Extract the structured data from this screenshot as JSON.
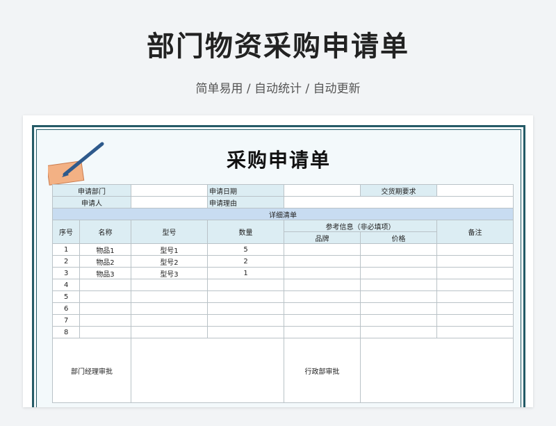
{
  "hero": {
    "title": "部门物资采购申请单",
    "subtitle": "简单易用 / 自动统计 / 自动更新"
  },
  "sheet": {
    "title": "采购申请单",
    "icon": "note-pencil-icon",
    "fields": {
      "dept_label": "申请部门",
      "date_label": "申请日期",
      "delivery_label": "交货期要求",
      "applicant_label": "申请人",
      "reason_label": "申请理由"
    },
    "section_label": "详细清单",
    "columns": {
      "index": "序号",
      "name": "名称",
      "model": "型号",
      "qty": "数量",
      "ref_group": "参考信息（非必填项）",
      "brand": "品牌",
      "price": "价格",
      "remark": "备注"
    },
    "rows": [
      {
        "index": "1",
        "name": "物品1",
        "model": "型号1",
        "qty": "5",
        "brand": "",
        "price": "",
        "remark": ""
      },
      {
        "index": "2",
        "name": "物品2",
        "model": "型号2",
        "qty": "2",
        "brand": "",
        "price": "",
        "remark": ""
      },
      {
        "index": "3",
        "name": "物品3",
        "model": "型号3",
        "qty": "1",
        "brand": "",
        "price": "",
        "remark": ""
      },
      {
        "index": "4",
        "name": "",
        "model": "",
        "qty": "",
        "brand": "",
        "price": "",
        "remark": ""
      },
      {
        "index": "5",
        "name": "",
        "model": "",
        "qty": "",
        "brand": "",
        "price": "",
        "remark": ""
      },
      {
        "index": "6",
        "name": "",
        "model": "",
        "qty": "",
        "brand": "",
        "price": "",
        "remark": ""
      },
      {
        "index": "7",
        "name": "",
        "model": "",
        "qty": "",
        "brand": "",
        "price": "",
        "remark": ""
      },
      {
        "index": "8",
        "name": "",
        "model": "",
        "qty": "",
        "brand": "",
        "price": "",
        "remark": ""
      }
    ],
    "approvals": {
      "dept_manager": "部门经理审批",
      "admin_dept": "行政部审批"
    }
  },
  "colors": {
    "frame": "#245a66",
    "label_bg": "#dcedf3",
    "section_bg": "#c8dcf1"
  }
}
